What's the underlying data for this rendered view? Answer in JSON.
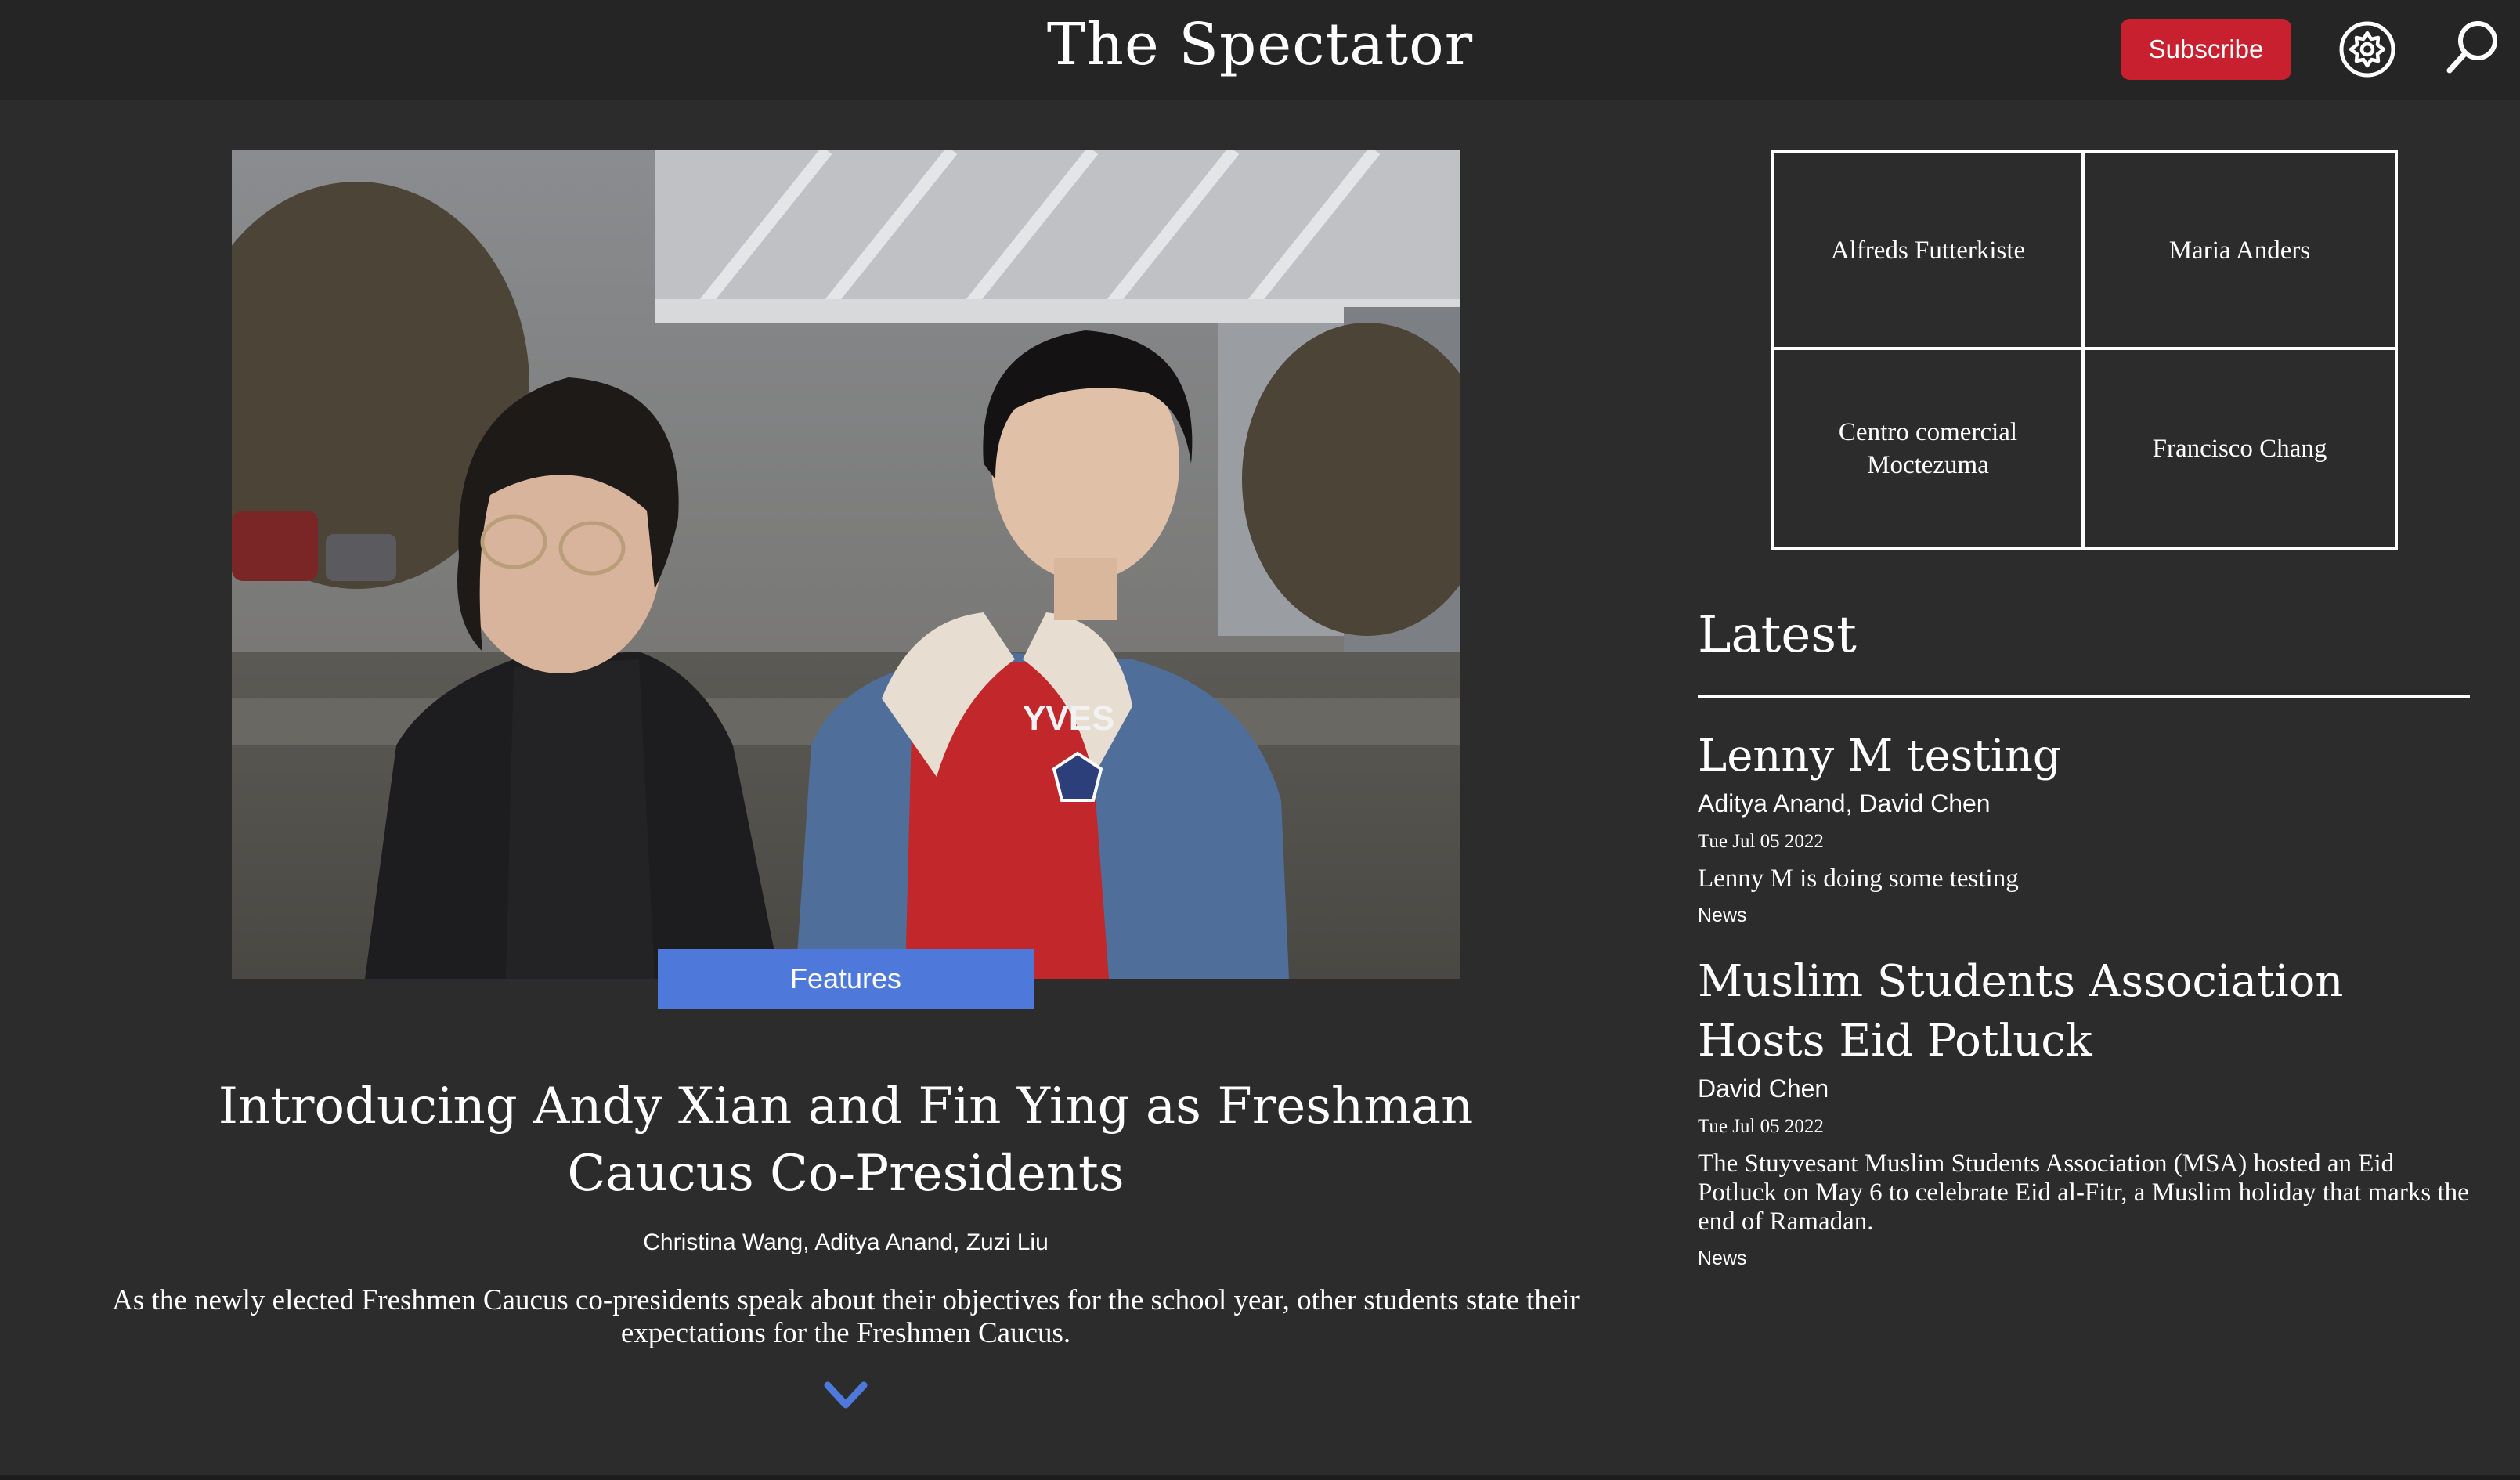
{
  "header": {
    "site_title": "The Spectator",
    "subscribe_label": "Subscribe",
    "settings_icon": "gear-icon",
    "search_icon": "search-icon"
  },
  "hero": {
    "image_alt": "Two students standing outdoors under an overpass",
    "category": "Features",
    "headline": "Introducing Andy Xian and Fin Ying as Freshman Caucus Co-Presidents",
    "authors": "Christina Wang, Aditya Anand, Zuzi Liu",
    "summary": "As the newly elected Freshmen Caucus co-presidents speak about their objectives for the school year, other students state their expectations for the Freshmen Caucus.",
    "scroll_icon": "chevron-down-icon"
  },
  "grid": {
    "cells": [
      "Alfreds Futterkiste",
      "Maria Anders",
      "Centro comercial Moctezuma",
      "Francisco Chang"
    ]
  },
  "latest": {
    "title": "Latest",
    "articles": [
      {
        "title": "Lenny M testing",
        "authors": "Aditya Anand, David Chen",
        "date": "Tue Jul 05 2022",
        "summary": "Lenny M is doing some testing",
        "section": "News"
      },
      {
        "title": "Muslim Students Association Hosts Eid Potluck",
        "authors": "David Chen",
        "date": "Tue Jul 05 2022",
        "summary": "The Stuyvesant Muslim Students Association (MSA) hosted an Eid Potluck on May 6 to celebrate Eid al-Fitr, a Muslim holiday that marks the end of Ramadan.",
        "section": "News"
      }
    ]
  },
  "colors": {
    "background": "#2d2c2d",
    "header": "#262526",
    "subscribe": "#c8202f",
    "category_tag": "#4e78d9"
  }
}
